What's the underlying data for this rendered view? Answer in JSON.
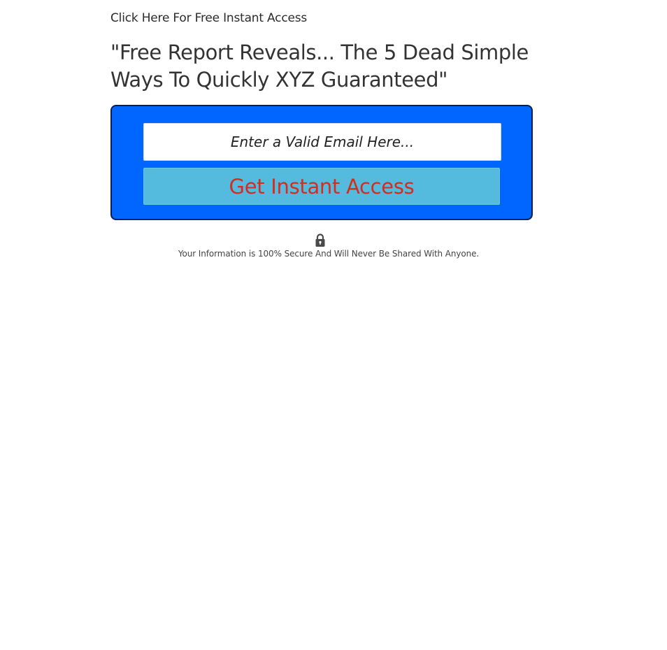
{
  "page": {
    "pre_heading": "Click Here For Free Instant Access",
    "headline": "\"Free Report Reveals... The 5 Dead Simple Ways To Quickly XYZ Guaranteed\""
  },
  "optin": {
    "email_placeholder": "Enter a Valid Email Here...",
    "button_label": "Get Instant Access",
    "box_color": "#0066ff",
    "button_color": "#54bbdf",
    "button_text_color": "#d12e1f"
  },
  "security": {
    "icon": "lock-icon",
    "note": "Your Information is 100% Secure And Will Never Be Shared With Anyone."
  }
}
